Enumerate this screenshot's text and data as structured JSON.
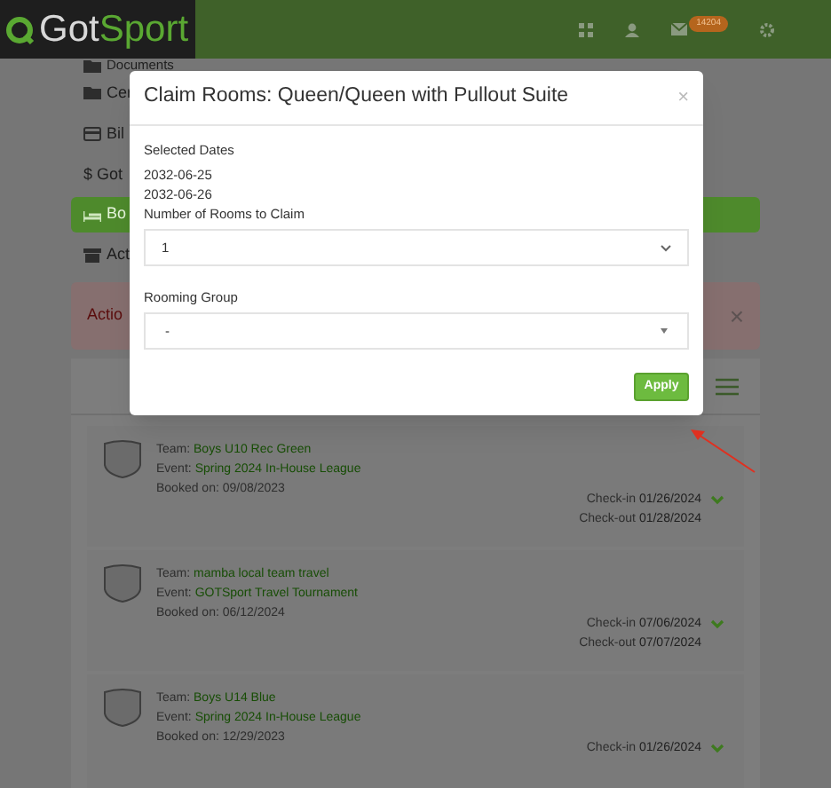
{
  "header": {
    "logo_parts": [
      "Got",
      "Sport"
    ],
    "badge": "14204"
  },
  "sidebar": {
    "items": [
      {
        "label": "Documents",
        "kind": "folder",
        "selected": false
      },
      {
        "label": "Cer",
        "kind": "folder",
        "selected": false
      },
      {
        "label": "Bil",
        "kind": "card",
        "selected": false
      },
      {
        "label": "$ Got",
        "kind": "none",
        "selected": false
      },
      {
        "label": "Bo",
        "kind": "bed",
        "selected": true
      },
      {
        "label": "Act",
        "kind": "archive",
        "selected": false
      }
    ]
  },
  "alert": {
    "text": "Actio",
    "close": "×"
  },
  "bookings": [
    {
      "team_label": "Team:",
      "team": "Boys U10 Rec Green",
      "event_label": "Event:",
      "event": "Spring 2024 In-House League",
      "booked_label": "Booked on:",
      "booked": "09/08/2023",
      "check_in_label": "Check-in",
      "check_in": "01/26/2024",
      "check_out_label": "Check-out",
      "check_out": "01/28/2024"
    },
    {
      "team_label": "Team:",
      "team": "mamba local team travel",
      "event_label": "Event:",
      "event": "GOTSport Travel Tournament",
      "booked_label": "Booked on:",
      "booked": "06/12/2024",
      "check_in_label": "Check-in",
      "check_in": "07/06/2024",
      "check_out_label": "Check-out",
      "check_out": "07/07/2024"
    },
    {
      "team_label": "Team:",
      "team": "Boys U14 Blue",
      "event_label": "Event:",
      "event": "Spring 2024 In-House League",
      "booked_label": "Booked on:",
      "booked": "12/29/2023",
      "check_in_label": "Check-in",
      "check_in": "01/26/2024"
    }
  ],
  "modal": {
    "title": "Claim Rooms: Queen/Queen with Pullout Suite",
    "close": "×",
    "dates_label": "Selected Dates",
    "dates": [
      "2032-06-25",
      "2032-06-26"
    ],
    "rooms_label": "Number of Rooms to Claim",
    "rooms_value": "1",
    "group_label": "Rooming Group",
    "group_value": "-",
    "apply": "Apply"
  }
}
